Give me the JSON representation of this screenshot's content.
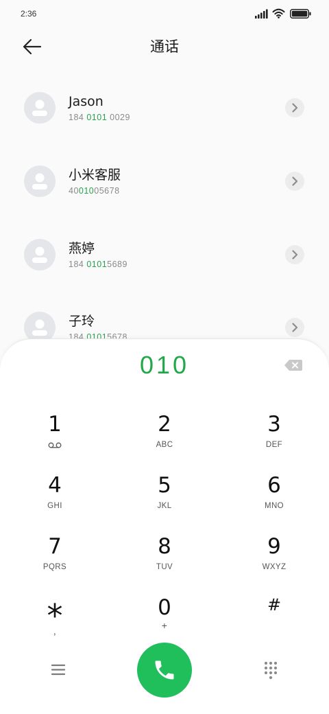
{
  "status_bar": {
    "time": "2:36",
    "signal_icon": "signal-icon",
    "wifi_icon": "wifi-icon",
    "battery_icon": "battery-icon"
  },
  "header": {
    "back_icon": "back-arrow-icon",
    "title": "通话"
  },
  "contacts": [
    {
      "name": "Jason",
      "number": {
        "pre": "184 ",
        "match": "0101",
        "post": " 0029"
      }
    },
    {
      "name": "小米客服",
      "number": {
        "pre": "40",
        "match": "010",
        "post": "05678"
      }
    },
    {
      "name": "燕婷",
      "number": {
        "pre": "184 ",
        "match": "0101",
        "post": "5689"
      }
    },
    {
      "name": "子玲",
      "number": {
        "pre": "184 ",
        "match": "0101",
        "post": "5678"
      }
    }
  ],
  "contact_details_icon": "chevron-right-icon",
  "dialer": {
    "input": "010",
    "backspace_icon": "backspace-icon",
    "keys": [
      {
        "digit": "1",
        "icon": "voicemail-icon"
      },
      {
        "digit": "2",
        "letters": "ABC"
      },
      {
        "digit": "3",
        "letters": "DEF"
      },
      {
        "digit": "4",
        "letters": "GHI"
      },
      {
        "digit": "5",
        "letters": "JKL"
      },
      {
        "digit": "6",
        "letters": "MNO"
      },
      {
        "digit": "7",
        "letters": "PQRS"
      },
      {
        "digit": "8",
        "letters": "TUV"
      },
      {
        "digit": "9",
        "letters": "WXYZ"
      },
      {
        "digit": "*",
        "letters": ","
      },
      {
        "digit": "0",
        "letters": "+"
      },
      {
        "digit": "#"
      }
    ]
  },
  "bottom_bar": {
    "menu_icon": "menu-icon",
    "call_icon": "phone-icon",
    "dialpad_icon": "dialpad-icon"
  },
  "colors": {
    "call_button": "#20bf5b",
    "input_text": "#22a74a",
    "match_highlight": "#27a24d",
    "avatar_bg": "#e5e6ea"
  }
}
